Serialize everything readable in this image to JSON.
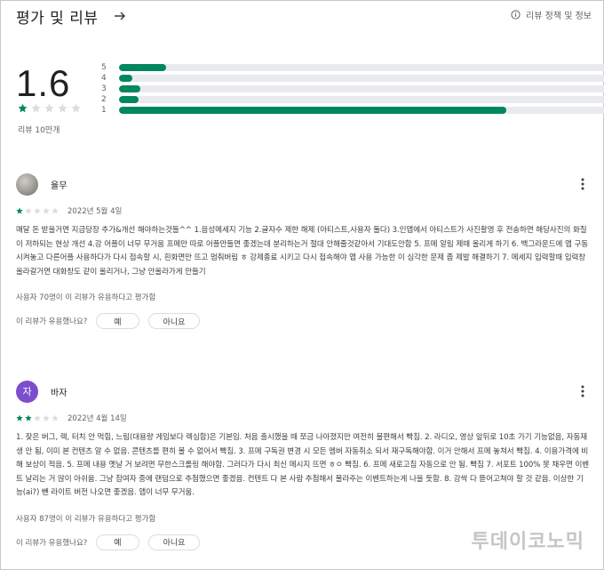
{
  "header": {
    "title": "평가 및 리뷰",
    "policy_label": "리뷰 정책 및 정보"
  },
  "summary": {
    "rating": "1.6",
    "stars_filled": 1,
    "review_count": "리뷰 10만개",
    "bars": [
      {
        "label": "5",
        "fraction": 0.095
      },
      {
        "label": "4",
        "fraction": 0.027
      },
      {
        "label": "3",
        "fraction": 0.044
      },
      {
        "label": "2",
        "fraction": 0.04
      },
      {
        "label": "1",
        "fraction": 0.785
      }
    ]
  },
  "reviews": [
    {
      "name": "율무",
      "avatar": "photo",
      "avatar_letter": "",
      "stars": 1,
      "date": "2022년 5월 4일",
      "text": "매달 돈 받을거면 지금당장 추가&개선 해야하는것들^^ 1.음성메세지 기능 2.글자수 제한 해제 (아티스트,사용자 둘다) 3.인앱에서 아티스트가 사진촬영 후 전송하면 해당사진의 화질이 저하되는 현상 개선 4.강 어플이 너무 무거움 프메만 따로 어플만들면 좋겠는데 분리하는거 절대 안해줄것같아서 기대도안함 5. 프메 알림 제때 올리게 하기 6. 백그라운드에 앱 구동시켜놓고 다른어플 사용하다가 다시 접속할 시, 흰화면만 뜨고 멈춰버림 ㅎ 강제종료 시키고 다시 접속해야 앱 사용 가능한 이 심각한 문제 좀 제발 해결하기 7. 메세지 입력할때 입력창 올라갈거면 대화창도 같이 올리거나, 그냥 안올라가게 만들기",
      "helpful_count": "사용자 70명이 이 리뷰가 유용하다고 평가함",
      "helpful_question": "이 리뷰가 유용했나요?",
      "yes_label": "예",
      "no_label": "아니요"
    },
    {
      "name": "바자",
      "avatar": "letter",
      "avatar_letter": "자",
      "stars": 2,
      "date": "2022년 4월 14일",
      "text": "1. 잦은 버그, 렉, 터치 안 먹힘, 느림(대용량 게임보다 렉심함)은 기본임. 처음 출시했을 때 쪼금 나아졌지만 여전히 불편해서 빡침. 2. 라디오, 영상 앞뒤로 10초 가기 기능없음, 자동재생 안 됨, 이미 본 컨텐츠 알 수 없음. 콘텐츠를 편히 볼 수 없어서 빡침. 3. 프메 구독권 변경 시 모든 멤버 자동취소 되서 재구독해야함. 이거 안해서 프메 놓쳐서 빡침. 4. 이용가격에 비해 보상이 적음. 5. 프메 내용 옛날 거 보려면 무한스크롤링 해야함. 그러다가 다시 최신 메시지 뜨면 ㅎㅇ 빡침. 6. 프메 새로고침 자동으로 안 됨. 빡침 7. 서포트 100% 못 채우면 이벤트 날리는 거 많이 아쉬움. 그냥 참여자 중에 랜덤으로 추첨했으면 좋겠음. 컨텐트 다 본 사람 추첨해서 몰라주는 이벤트하는게 나을 듯함. 8. 강싹 다 뜯어고쳐야 할 것 같음. 이상한 기능(ai?) 뺀 라이트 버전 나오면 좋겠음. 앱이 너무 무거움.",
      "helpful_count": "사용자 87명이 이 리뷰가 유용하다고 평가함",
      "helpful_question": "이 리뷰가 유용했나요?",
      "yes_label": "예",
      "no_label": "아니요"
    }
  ],
  "watermark": "투데이코노믹",
  "colors": {
    "accent": "#01875f",
    "track": "#e8eaed",
    "avatar_letter_bg": "#7c4dcc"
  },
  "icons": {
    "back": "arrow-right-icon",
    "policy": "info-icon",
    "more": "more-vert-icon",
    "star": "star-icon"
  }
}
